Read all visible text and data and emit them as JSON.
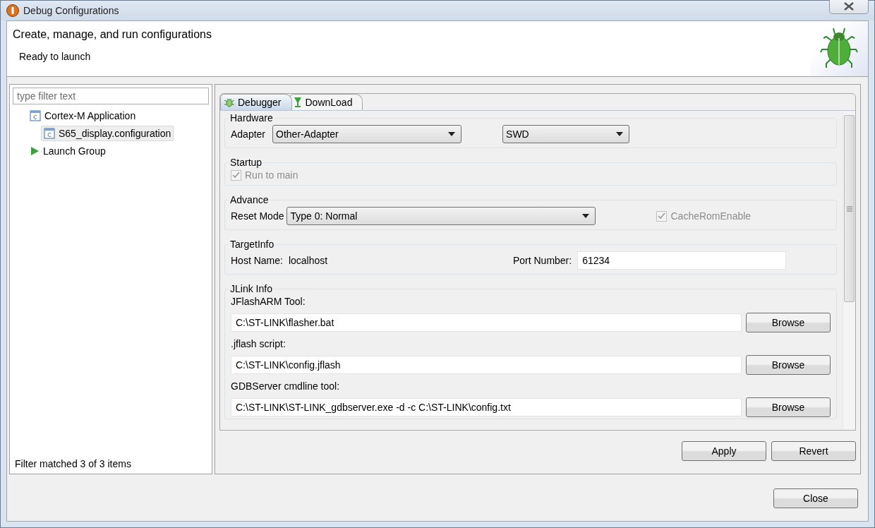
{
  "window": {
    "title": "Debug Configurations"
  },
  "header": {
    "title": "Create, manage, and run configurations",
    "message": "Ready to launch"
  },
  "sidebar": {
    "filter_placeholder": "type filter text",
    "tree": [
      {
        "label": "Cortex-M Application",
        "kind": "config-type",
        "selected": false,
        "children": [
          {
            "label": "S65_display.configuration",
            "kind": "config",
            "selected": true
          }
        ]
      },
      {
        "label": "Launch Group",
        "kind": "launch-group",
        "selected": false
      }
    ],
    "status": "Filter matched 3 of 3 items"
  },
  "tabs": [
    {
      "label": "Debugger",
      "kind": "bug",
      "selected": true
    },
    {
      "label": "DownLoad",
      "kind": "download",
      "selected": false
    }
  ],
  "hardware": {
    "legend": "Hardware",
    "adapter_label": "Adapter",
    "adapter_value": "Other-Adapter",
    "interface_value": "SWD"
  },
  "startup": {
    "legend": "Startup",
    "run_to_main": {
      "label": "Run to main",
      "checked": true,
      "disabled": true
    }
  },
  "advance": {
    "legend": "Advance",
    "reset_mode_label": "Reset Mode",
    "reset_mode_value": "Type 0: Normal",
    "cache_rom": {
      "label": "CacheRomEnable",
      "checked": true,
      "disabled": true
    }
  },
  "target_info": {
    "legend": "TargetInfo",
    "host_label": "Host Name:",
    "host_value": "localhost",
    "port_label": "Port Number:",
    "port_value": "61234"
  },
  "jlink": {
    "legend": "JLink Info",
    "fields": [
      {
        "label": "JFlashARM Tool:",
        "value": "C:\\ST-LINK\\flasher.bat",
        "button": "Browse"
      },
      {
        "label": ".jflash script:",
        "value": "C:\\ST-LINK\\config.jflash",
        "button": "Browse"
      },
      {
        "label": "GDBServer cmdline tool:",
        "value": "C:\\ST-LINK\\ST-LINK_gdbserver.exe -d -c C:\\ST-LINK\\config.txt",
        "button": "Browse"
      }
    ]
  },
  "panel_buttons": [
    "Apply",
    "Revert"
  ],
  "dialog_buttons": [
    "Close"
  ]
}
